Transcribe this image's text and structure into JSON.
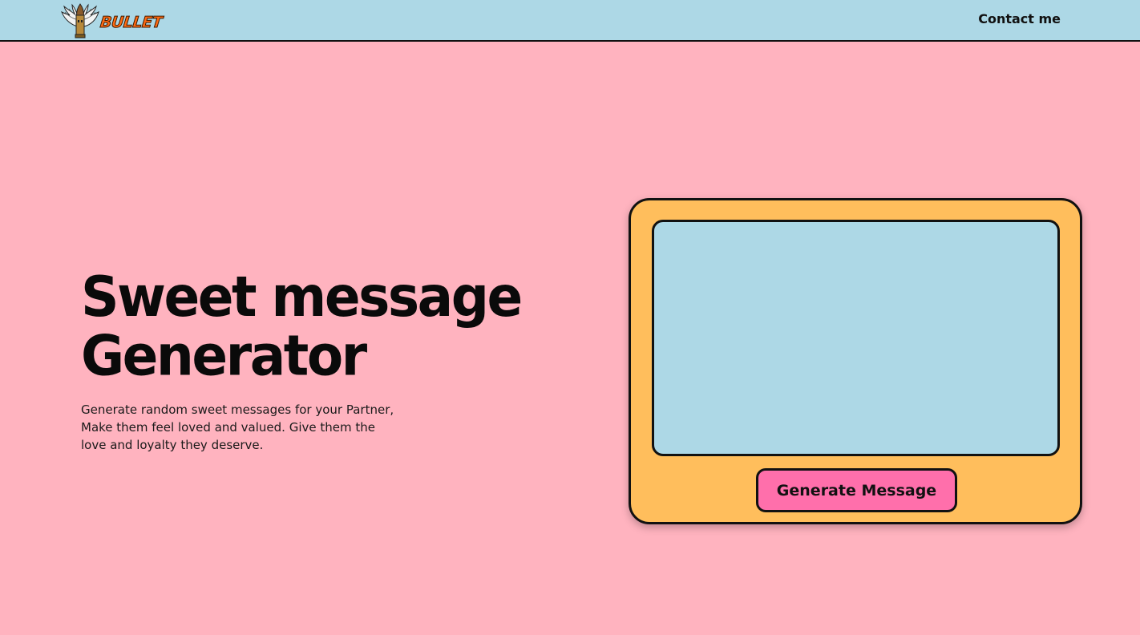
{
  "navbar": {
    "logo": {
      "icon": "winged-bullet-icon",
      "text": "BULLET"
    },
    "contact_label": "Contact me"
  },
  "hero": {
    "title_line1": "Sweet message",
    "title_line2": "Generator",
    "description": "Generate random sweet messages for your Partner, Make them feel loved and valued. Give them the love and loyalty they deserve."
  },
  "generator": {
    "message_text": "",
    "button_label": "Generate Message"
  },
  "colors": {
    "background": "#ffb3bf",
    "navbar": "#add8e6",
    "card": "#ffbe5c",
    "message_box": "#add8e6",
    "button": "#ff6fab",
    "logo_text": "#ff6a13"
  }
}
